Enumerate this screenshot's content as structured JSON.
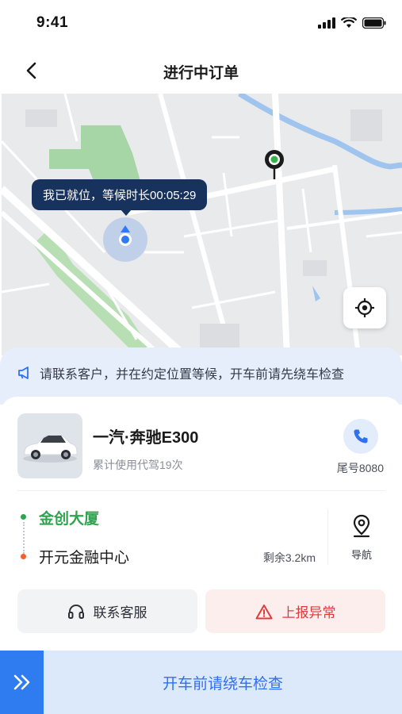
{
  "status_bar": {
    "time": "9:41"
  },
  "nav": {
    "title": "进行中订单"
  },
  "map": {
    "waiting_text": "我已就位，等候时长00:05:29"
  },
  "notice": {
    "text": "请联系客户，并在约定位置等候，开车前请先绕车检查"
  },
  "vehicle": {
    "name": "一汽·奔驰E300",
    "usage": "累计使用代驾19次",
    "plate": "尾号8080"
  },
  "route": {
    "start": "金创大厦",
    "end": "开元金融中心",
    "remaining": "剩余3.2km",
    "nav_label": "导航"
  },
  "actions": {
    "service_label": "联系客服",
    "report_label": "上报异常"
  },
  "slider": {
    "text": "开车前请绕车检查"
  },
  "colors": {
    "accent": "#2f7bf0",
    "start": "#2ea44f",
    "end": "#f0612b",
    "danger": "#e03b3b"
  }
}
